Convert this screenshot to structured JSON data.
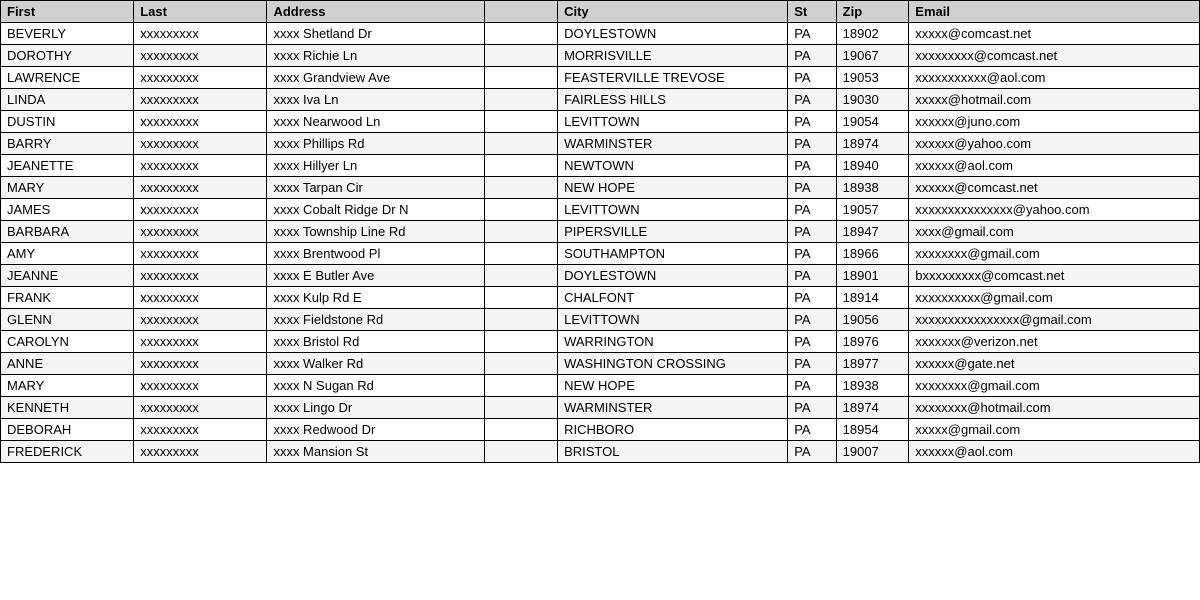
{
  "table": {
    "headers": [
      "First",
      "Last",
      "Address",
      "",
      "City",
      "St",
      "Zip",
      "Email"
    ],
    "rows": [
      [
        "BEVERLY",
        "xxxxxxxxx",
        "xxxx Shetland Dr",
        "",
        "DOYLESTOWN",
        "PA",
        "18902",
        "xxxxx@comcast.net"
      ],
      [
        "DOROTHY",
        "xxxxxxxxx",
        "xxxx Richie Ln",
        "",
        "MORRISVILLE",
        "PA",
        "19067",
        "xxxxxxxxx@comcast.net"
      ],
      [
        "LAWRENCE",
        "xxxxxxxxx",
        "xxxx Grandview Ave",
        "",
        "FEASTERVILLE TREVOSE",
        "PA",
        "19053",
        "xxxxxxxxxxx@aol.com"
      ],
      [
        "LINDA",
        "xxxxxxxxx",
        "xxxx Iva Ln",
        "",
        "FAIRLESS HILLS",
        "PA",
        "19030",
        "xxxxx@hotmail.com"
      ],
      [
        "DUSTIN",
        "xxxxxxxxx",
        "xxxx Nearwood Ln",
        "",
        "LEVITTOWN",
        "PA",
        "19054",
        "xxxxxx@juno.com"
      ],
      [
        "BARRY",
        "xxxxxxxxx",
        "xxxx Phillips Rd",
        "",
        "WARMINSTER",
        "PA",
        "18974",
        "xxxxxx@yahoo.com"
      ],
      [
        "JEANETTE",
        "xxxxxxxxx",
        "xxxx Hillyer Ln",
        "",
        "NEWTOWN",
        "PA",
        "18940",
        "xxxxxx@aol.com"
      ],
      [
        "MARY",
        "xxxxxxxxx",
        "xxxx Tarpan Cir",
        "",
        "NEW HOPE",
        "PA",
        "18938",
        "xxxxxx@comcast.net"
      ],
      [
        "JAMES",
        "xxxxxxxxx",
        "xxxx Cobalt Ridge Dr N",
        "",
        "LEVITTOWN",
        "PA",
        "19057",
        "xxxxxxxxxxxxxxx@yahoo.com"
      ],
      [
        "BARBARA",
        "xxxxxxxxx",
        "xxxx Township Line Rd",
        "",
        "PIPERSVILLE",
        "PA",
        "18947",
        "xxxx@gmail.com"
      ],
      [
        "AMY",
        "xxxxxxxxx",
        "xxxx Brentwood Pl",
        "",
        "SOUTHAMPTON",
        "PA",
        "18966",
        "xxxxxxxx@gmail.com"
      ],
      [
        "JEANNE",
        "xxxxxxxxx",
        "xxxx E Butler Ave",
        "",
        "DOYLESTOWN",
        "PA",
        "18901",
        "bxxxxxxxxx@comcast.net"
      ],
      [
        "FRANK",
        "xxxxxxxxx",
        "xxxx Kulp Rd E",
        "",
        "CHALFONT",
        "PA",
        "18914",
        "xxxxxxxxxx@gmail.com"
      ],
      [
        "GLENN",
        "xxxxxxxxx",
        "xxxx Fieldstone Rd",
        "",
        "LEVITTOWN",
        "PA",
        "19056",
        "xxxxxxxxxxxxxxxx@gmail.com"
      ],
      [
        "CAROLYN",
        "xxxxxxxxx",
        "xxxx Bristol Rd",
        "",
        "WARRINGTON",
        "PA",
        "18976",
        "xxxxxxx@verizon.net"
      ],
      [
        "ANNE",
        "xxxxxxxxx",
        "xxxx Walker Rd",
        "",
        "WASHINGTON CROSSING",
        "PA",
        "18977",
        "xxxxxx@gate.net"
      ],
      [
        "MARY",
        "xxxxxxxxx",
        "xxxx N Sugan Rd",
        "",
        "NEW HOPE",
        "PA",
        "18938",
        "xxxxxxxx@gmail.com"
      ],
      [
        "KENNETH",
        "xxxxxxxxx",
        "xxxx Lingo Dr",
        "",
        "WARMINSTER",
        "PA",
        "18974",
        "xxxxxxxx@hotmail.com"
      ],
      [
        "DEBORAH",
        "xxxxxxxxx",
        "xxxx Redwood Dr",
        "",
        "RICHBORO",
        "PA",
        "18954",
        "xxxxx@gmail.com"
      ],
      [
        "FREDERICK",
        "xxxxxxxxx",
        "xxxx Mansion St",
        "",
        "BRISTOL",
        "PA",
        "19007",
        "xxxxxx@aol.com"
      ]
    ]
  }
}
